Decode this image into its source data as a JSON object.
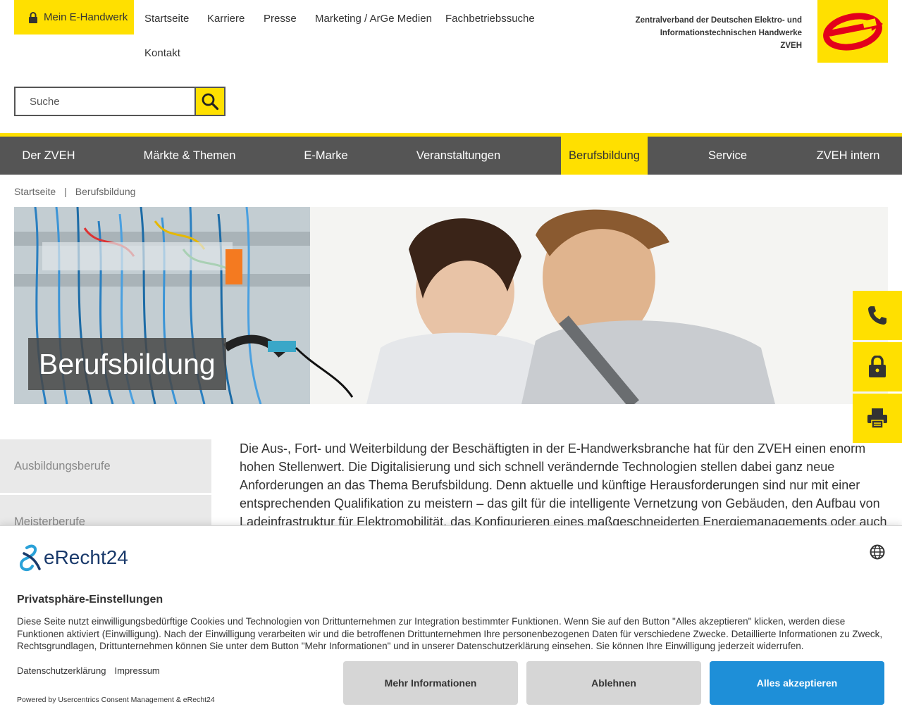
{
  "header": {
    "mein_label": "Mein E-Handwerk",
    "nav": [
      "Startseite",
      "Karriere",
      "Presse",
      "Marketing / ArGe Medien",
      "Fachbetriebssuche",
      "Kontakt"
    ],
    "org_line1": "Zentralverband der Deutschen Elektro- und",
    "org_line2": "Informationstechnischen Handwerke",
    "org_line3": "ZVEH"
  },
  "search": {
    "placeholder": "Suche"
  },
  "main_nav": [
    "Der ZVEH",
    "Märkte & Themen",
    "E-Marke",
    "Veranstaltungen",
    "Berufsbildung",
    "Service",
    "ZVEH intern"
  ],
  "main_nav_active": "Berufsbildung",
  "breadcrumb": {
    "home": "Startseite",
    "separator": "|",
    "current": "Berufsbildung"
  },
  "hero": {
    "title": "Berufsbildung"
  },
  "sidebar": {
    "items": [
      "Ausbildungsberufe",
      "Meisterberufe"
    ]
  },
  "content": {
    "paragraph": "Die Aus-, Fort- und Weiterbildung der Beschäftigten in der E-Handwerksbranche hat für den ZVEH einen enorm hohen Stellenwert. Die Digitalisierung und sich schnell verändernde Technologien stellen dabei ganz neue Anforderungen an das Thema Berufsbildung. Denn aktuelle und künftige Herausforderungen sind nur mit einer entsprechenden Qualifikation zu meistern – das gilt für die intelligente Vernetzung von Gebäuden, den Aufbau von Ladeinfrastruktur für Elektromobilität, das Konfigurieren eines maßgeschneiderten Energiemanagements oder auch"
  },
  "side_widgets": [
    "phone-icon",
    "lock-icon",
    "printer-icon"
  ],
  "consent": {
    "brand": "eRecht24",
    "title": "Privatsphäre-Einstellungen",
    "text": "Diese Seite nutzt einwilligungsbedürftige Cookies und Technologien von Drittunternehmen zur Integration bestimmter Funktionen. Wenn Sie auf den Button \"Alles akzeptieren\" klicken, werden diese Funktionen aktiviert (Einwilligung). Nach der Einwilligung verarbeiten wir und die betroffenen Drittunternehmen Ihre personenbezogenen Daten für verschiedene Zwecke. Detaillierte Informationen zu Zweck, Rechtsgrundlagen, Drittunternehmen können Sie unter dem Button \"Mehr Informationen\" und in unserer Datenschutzerklärung einsehen. Sie können Ihre Einwilligung jederzeit widerrufen.",
    "link_privacy": "Datenschutzerklärung",
    "link_imprint": "Impressum",
    "powered": "Powered by Usercentrics Consent Management & eRecht24",
    "btn_more": "Mehr Informationen",
    "btn_reject": "Ablehnen",
    "btn_accept": "Alles akzeptieren"
  },
  "colors": {
    "brand_yellow": "#ffe000",
    "nav_grey": "#555555",
    "logo_red": "#e3001b",
    "accept_blue": "#1e8fd8"
  }
}
